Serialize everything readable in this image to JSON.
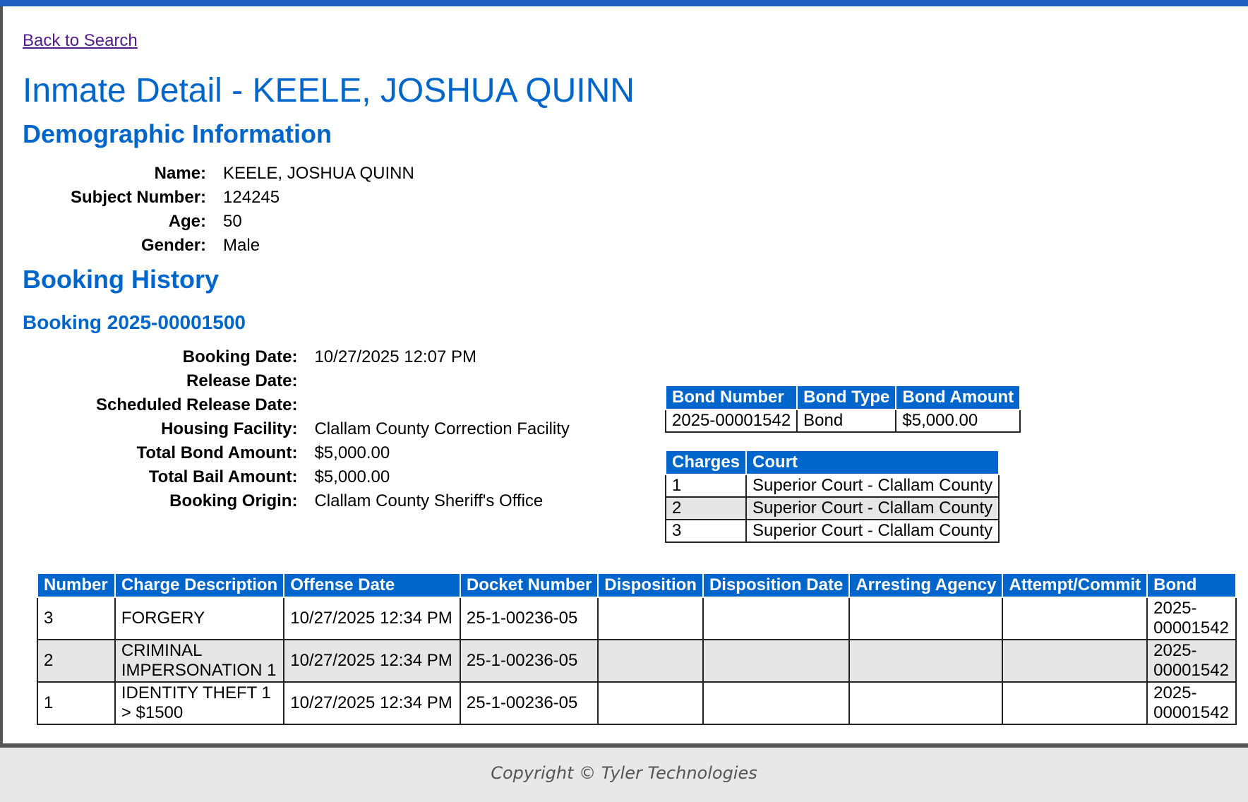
{
  "nav": {
    "back_label": "Back to Search"
  },
  "page": {
    "title": "Inmate Detail - KEELE, JOSHUA QUINN"
  },
  "demographics": {
    "heading": "Demographic Information",
    "rows": [
      {
        "label": "Name:",
        "value": "KEELE, JOSHUA QUINN"
      },
      {
        "label": "Subject Number:",
        "value": "124245"
      },
      {
        "label": "Age:",
        "value": "50"
      },
      {
        "label": "Gender:",
        "value": "Male"
      }
    ]
  },
  "booking_history": {
    "heading": "Booking History",
    "booking": {
      "heading": "Booking 2025-00001500",
      "rows": [
        {
          "label": "Booking Date:",
          "value": "10/27/2025 12:07 PM"
        },
        {
          "label": "Release Date:",
          "value": ""
        },
        {
          "label": "Scheduled Release Date:",
          "value": ""
        },
        {
          "label": "Housing Facility:",
          "value": "Clallam County Correction Facility"
        },
        {
          "label": "Total Bond Amount:",
          "value": "$5,000.00"
        },
        {
          "label": "Total Bail Amount:",
          "value": "$5,000.00"
        },
        {
          "label": "Booking Origin:",
          "value": "Clallam County Sheriff's Office"
        }
      ],
      "bonds": {
        "headers": [
          "Bond Number",
          "Bond Type",
          "Bond Amount"
        ],
        "rows": [
          [
            "2025-00001542",
            "Bond",
            "$5,000.00"
          ]
        ]
      },
      "courts": {
        "headers": [
          "Charges",
          "Court"
        ],
        "rows": [
          [
            "1",
            "Superior Court - Clallam County"
          ],
          [
            "2",
            "Superior Court - Clallam County"
          ],
          [
            "3",
            "Superior Court - Clallam County"
          ]
        ]
      },
      "charges": {
        "headers": [
          "Number",
          "Charge Description",
          "Offense Date",
          "Docket Number",
          "Disposition",
          "Disposition Date",
          "Arresting Agency",
          "Attempt/Commit",
          "Bond"
        ],
        "rows": [
          [
            "3",
            "FORGERY",
            "10/27/2025 12:34 PM",
            "25-1-00236-05",
            "",
            "",
            "",
            "",
            "2025-00001542"
          ],
          [
            "2",
            "CRIMINAL IMPERSONATION 1",
            "10/27/2025 12:34 PM",
            "25-1-00236-05",
            "",
            "",
            "",
            "",
            "2025-00001542"
          ],
          [
            "1",
            "IDENTITY THEFT 1 > $1500",
            "10/27/2025 12:34 PM",
            "25-1-00236-05",
            "",
            "",
            "",
            "",
            "2025-00001542"
          ]
        ]
      }
    }
  },
  "footer": {
    "copyright": "Copyright © Tyler Technologies"
  }
}
